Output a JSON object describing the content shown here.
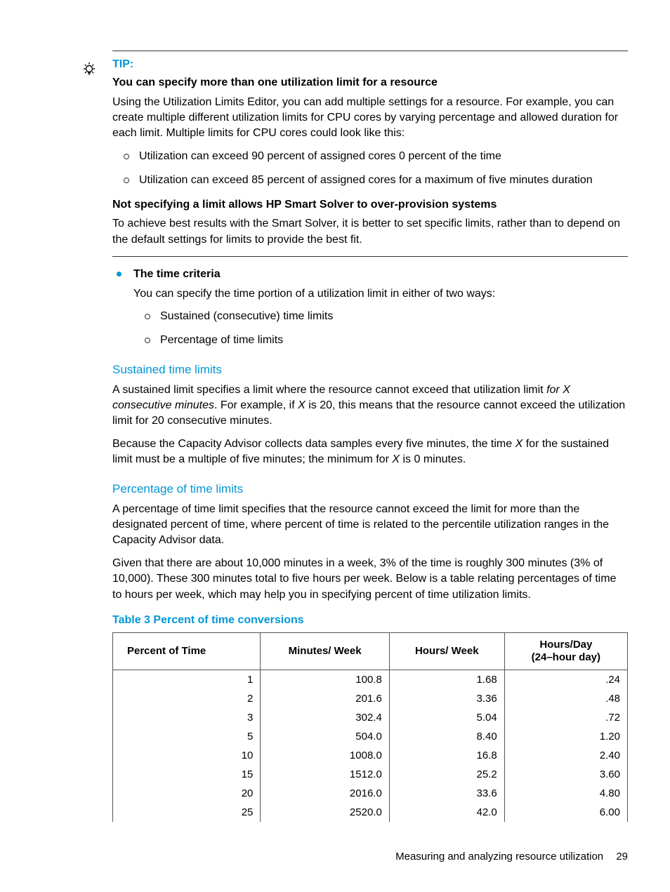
{
  "tip": {
    "label": "TIP:",
    "h1": "You can specify more than one utilization limit for a resource",
    "p1": "Using the Utilization Limits Editor, you can add multiple settings for a resource. For example, you can create multiple different utilization limits for CPU cores by varying percentage and allowed duration for each limit. Multiple limits for CPU cores could look like this:",
    "b1": "Utilization can exceed 90 percent of assigned cores 0 percent of the time",
    "b2": "Utilization can exceed 85 percent of assigned cores for a maximum of five minutes duration",
    "h2": "Not specifying a limit allows HP Smart Solver to over-provision systems",
    "p2": "To achieve best results with the Smart Solver, it is better to set specific limits, rather than to depend on the default settings for limits to provide the best fit."
  },
  "timeCriteria": {
    "title": "The time criteria",
    "intro": "You can specify the time portion of a utilization limit in either of two ways:",
    "b1": "Sustained (consecutive) time limits",
    "b2": "Percentage of time limits"
  },
  "sustained": {
    "title": "Sustained time limits",
    "p1a": "A sustained limit specifies a limit where the resource cannot exceed that utilization limit ",
    "p1b": "for X consecutive minutes",
    "p1c": ". For example, if ",
    "p1d": "X",
    "p1e": " is 20, this means that the resource cannot exceed the utilization limit for 20 consecutive minutes.",
    "p2a": "Because the Capacity Advisor collects data samples every five minutes, the time ",
    "p2b": "X",
    "p2c": " for the sustained limit must be a multiple of five minutes; the minimum for ",
    "p2d": "X",
    "p2e": " is 0 minutes."
  },
  "percentage": {
    "title": "Percentage of time limits",
    "p1": "A percentage of time limit specifies that the resource cannot exceed the limit for more than the designated percent of time, where percent of time is related to the percentile utilization ranges in the Capacity Advisor data.",
    "p2": "Given that there are about 10,000 minutes in a week, 3% of the time is roughly 300 minutes (3% of 10,000). These 300 minutes total to five hours per week. Below is a table relating percentages of time to hours per week, which may help you in specifying percent of time utilization limits."
  },
  "table": {
    "title": "Table 3 Percent of time conversions",
    "headers": [
      "Percent of Time",
      "Minutes/ Week",
      "Hours/ Week",
      "Hours/Day\n(24–hour day)"
    ],
    "rows": [
      [
        "1",
        "100.8",
        "1.68",
        ".24"
      ],
      [
        "2",
        "201.6",
        "3.36",
        ".48"
      ],
      [
        "3",
        "302.4",
        "5.04",
        ".72"
      ],
      [
        "5",
        "504.0",
        "8.40",
        "1.20"
      ],
      [
        "10",
        "1008.0",
        "16.8",
        "2.40"
      ],
      [
        "15",
        "1512.0",
        "25.2",
        "3.60"
      ],
      [
        "20",
        "2016.0",
        "33.6",
        "4.80"
      ],
      [
        "25",
        "2520.0",
        "42.0",
        "6.00"
      ]
    ]
  },
  "footer": {
    "text": "Measuring and analyzing resource utilization",
    "page": "29"
  },
  "chart_data": {
    "type": "table",
    "title": "Table 3 Percent of time conversions",
    "columns": [
      "Percent of Time",
      "Minutes/Week",
      "Hours/Week",
      "Hours/Day (24-hour day)"
    ],
    "rows": [
      [
        1,
        100.8,
        1.68,
        0.24
      ],
      [
        2,
        201.6,
        3.36,
        0.48
      ],
      [
        3,
        302.4,
        5.04,
        0.72
      ],
      [
        5,
        504.0,
        8.4,
        1.2
      ],
      [
        10,
        1008.0,
        16.8,
        2.4
      ],
      [
        15,
        1512.0,
        25.2,
        3.6
      ],
      [
        20,
        2016.0,
        33.6,
        4.8
      ],
      [
        25,
        2520.0,
        42.0,
        6.0
      ]
    ]
  }
}
